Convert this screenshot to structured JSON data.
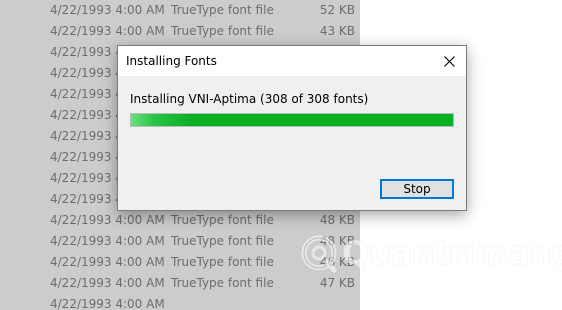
{
  "file_list": {
    "rows": [
      {
        "date": "4/22/1993 4:00 AM",
        "type": "TrueType font file",
        "size": "52 KB"
      },
      {
        "date": "4/22/1993 4:00 AM",
        "type": "TrueType font file",
        "size": "43 KB"
      },
      {
        "date": "4/22/1993 4:00 AM",
        "type": "",
        "size": ""
      },
      {
        "date": "4/22/1993 4:00 AM",
        "type": "",
        "size": ""
      },
      {
        "date": "4/22/1993 4:00 AM",
        "type": "",
        "size": ""
      },
      {
        "date": "4/22/1993 4:00 AM",
        "type": "",
        "size": ""
      },
      {
        "date": "4/22/1993 4:00 AM",
        "type": "",
        "size": ""
      },
      {
        "date": "4/22/1993 4:00 AM",
        "type": "",
        "size": ""
      },
      {
        "date": "4/22/1993 4:00 AM",
        "type": "",
        "size": ""
      },
      {
        "date": "4/22/1993 4:00 AM",
        "type": "",
        "size": ""
      },
      {
        "date": "4/22/1993 4:00 AM",
        "type": "TrueType font file",
        "size": "48 KB"
      },
      {
        "date": "4/22/1993 4:00 AM",
        "type": "TrueType font file",
        "size": "48 KB"
      },
      {
        "date": "4/22/1993 4:00 AM",
        "type": "TrueType font file",
        "size": "46 KB"
      },
      {
        "date": "4/22/1993 4:00 AM",
        "type": "TrueType font file",
        "size": "47 KB"
      },
      {
        "date": "4/22/1993 4:00 AM",
        "type": "",
        "size": ""
      }
    ]
  },
  "dialog": {
    "title": "Installing Fonts",
    "close_icon": "close-icon",
    "status": "Installing VNI-Aptima (308 of 308 fonts)",
    "progress_fraction": 1.0,
    "stop_label": "Stop"
  },
  "watermark": {
    "text": "Quantrimang"
  },
  "colors": {
    "list_background": "#cccccc",
    "list_text": "#6d6d6d",
    "dialog_background": "#f0f0f0",
    "progress_green": "#06b025",
    "button_focus_border": "#0078d7"
  }
}
